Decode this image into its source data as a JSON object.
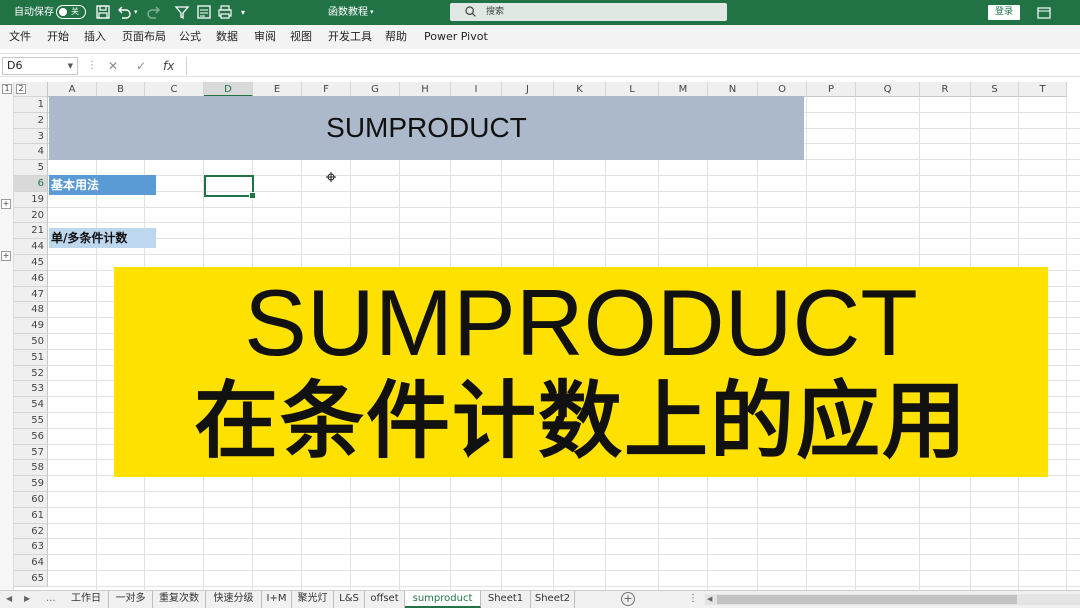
{
  "titlebar": {
    "autosave_label": "自动保存",
    "autosave_state": "关",
    "filename": "函数教程",
    "search_placeholder": "搜索",
    "login_label": "登录"
  },
  "menu": [
    "文件",
    "开始",
    "插入",
    "页面布局",
    "公式",
    "数据",
    "审阅",
    "视图",
    "开发工具",
    "帮助",
    "Power Pivot"
  ],
  "formula_bar": {
    "name_box": "D6",
    "fx": "fx",
    "formula": ""
  },
  "grid": {
    "columns": [
      "A",
      "B",
      "C",
      "D",
      "E",
      "F",
      "G",
      "H",
      "I",
      "J",
      "K",
      "L",
      "M",
      "N",
      "O",
      "P",
      "Q",
      "R",
      "S",
      "T"
    ],
    "selected_column": "D",
    "rows": [
      "1",
      "2",
      "3",
      "4",
      "5",
      "6",
      "19",
      "20",
      "21",
      "44",
      "45",
      "46",
      "47",
      "48",
      "49",
      "50",
      "51",
      "52",
      "53",
      "54",
      "55",
      "56",
      "57",
      "58",
      "59",
      "60",
      "61",
      "62",
      "63",
      "64",
      "65"
    ],
    "selected_row": "6",
    "outline_levels": [
      "1",
      "2"
    ],
    "title": "SUMPRODUCT",
    "section_basic": "基本用法",
    "section_count": "单/多条件计数"
  },
  "banner": {
    "line1": "SUMPRODUCT",
    "line2": "在条件计数上的应用",
    "color": "#ffe100"
  },
  "sheet_tabs": [
    "工作日",
    "一对多",
    "重复次数",
    "快速分级",
    "I+M",
    "聚光灯",
    "L&S",
    "offset",
    "sumproduct",
    "Sheet1",
    "Sheet2"
  ],
  "active_sheet": "sumproduct",
  "colors": {
    "excel_green": "#217346",
    "title_band": "#acb9ca",
    "section_blue": "#5b9bd5",
    "section_light": "#bdd7ee"
  }
}
